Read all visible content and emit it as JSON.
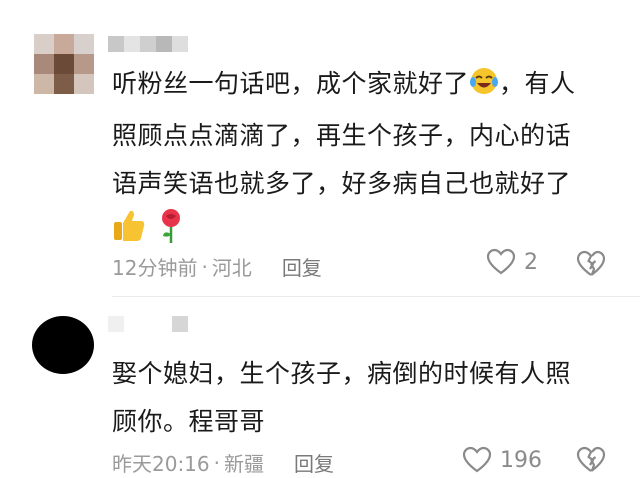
{
  "comments": [
    {
      "text_lines": [
        "听粉丝一句话吧，成个家就好了",
        "，有人",
        "照顾点点滴滴了，再生个孩子，内心的话",
        "语声笑语也就多了，好多病自己也就好了"
      ],
      "emojis": [
        "laughing-crying-emoji",
        "thumbs-up-emoji",
        "rose-emoji"
      ],
      "time": "12分钟前",
      "dot": "·",
      "location": "河北",
      "reply_label": "回复",
      "like_count": "2"
    },
    {
      "text_lines": [
        "娶个媳妇，生个孩子，病倒的时候有人照",
        "顾你。程哥哥"
      ],
      "time": "昨天20:16",
      "dot": "·",
      "location": "新疆",
      "reply_label": "回复",
      "like_count": "196"
    }
  ],
  "colors": {
    "text": "#1a1a1a",
    "meta": "#9a9a9a",
    "icon": "#8a8a8a"
  }
}
